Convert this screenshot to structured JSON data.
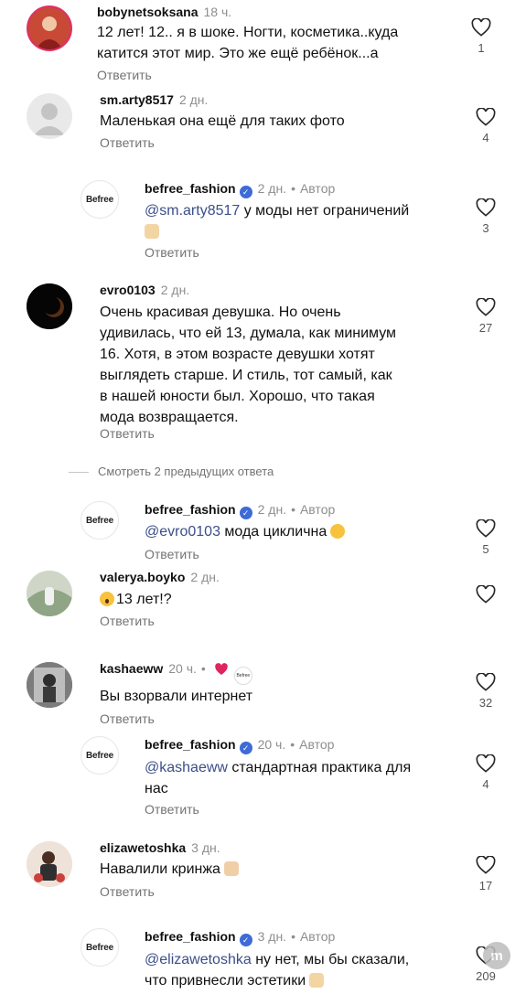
{
  "reply_label": "Ответить",
  "view_more": "Смотреть 2 предыдущих ответа",
  "comments": [
    {
      "user": "bobynetsoksana",
      "time": "18 ч.",
      "text_lines": [
        "12 лет! 12.. я в шоке. Ногти, косметика..куда",
        "катится этот мир. Это же ещё ребёнок...а"
      ],
      "likes": "1"
    },
    {
      "user": "sm.arty8517",
      "time": "2 дн.",
      "text_lines": [
        "Маленькая она ещё для таких фото"
      ],
      "likes": "4"
    },
    {
      "user": "befree_fashion",
      "time": "2 дн.",
      "author": "Автор",
      "avatar_text": "Befree",
      "mention": "@sm.arty8517",
      "text": "у моды нет ограничений",
      "likes": "3"
    },
    {
      "user": "evro0103",
      "time": "2 дн.",
      "text_lines": [
        "Очень красивая девушка. Но очень",
        "удивилась, что ей 13, думала,  как минимум",
        "16.  Хотя, в этом возрасте девушки хотят",
        "выглядеть  старше.  И стиль, тот самый, как",
        "в нашей юности был.  Хорошо, что такая",
        "мода возвращается."
      ],
      "likes": "27"
    },
    {
      "user": "befree_fashion",
      "time": "2 дн.",
      "author": "Автор",
      "avatar_text": "Befree",
      "mention": "@evro0103",
      "text": "мода циклична",
      "likes": "5"
    },
    {
      "user": "valerya.boyko",
      "time": "2 дн.",
      "text": "13 лет!?",
      "likes": ""
    },
    {
      "user": "kashaeww",
      "time": "20 ч.",
      "text": "Вы взорвали интернет",
      "likes": "32",
      "badge_text": "Befree"
    },
    {
      "user": "befree_fashion",
      "time": "20 ч.",
      "author": "Автор",
      "avatar_text": "Befree",
      "mention": "@kashaeww",
      "text": "стандартная практика для",
      "text_line2": "нас",
      "likes": "4"
    },
    {
      "user": "elizawetoshka",
      "time": "3 дн.",
      "text": "Навалили кринжа",
      "likes": "17"
    },
    {
      "user": "befree_fashion",
      "time": "3 дн.",
      "author": "Автор",
      "avatar_text": "Befree",
      "mention": "@elizawetoshka",
      "text": "ну нет, мы бы сказали,",
      "text_line2": "что привнесли эстетики",
      "likes": "209"
    }
  ],
  "colors": {
    "mention": "#3b4f8a",
    "verified": "#3d6bd7",
    "muted": "#8e8e8e",
    "heart_red": "#e0245e"
  },
  "icons": [
    "heart-outline-icon",
    "verified-icon",
    "red-heart-icon"
  ]
}
